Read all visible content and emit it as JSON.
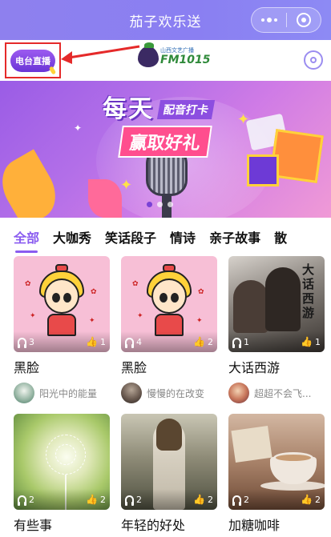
{
  "app": {
    "title": "茄子欢乐送"
  },
  "header": {
    "live_badge": "电台直播",
    "station_small": "山西文艺广播",
    "station_freq": "FM1015"
  },
  "banner": {
    "line1_big": "每天",
    "line1_tag": "配音打卡",
    "line2": "赢取好礼",
    "active_dot": 0,
    "dot_count": 3
  },
  "tabs": [
    {
      "label": "全部"
    },
    {
      "label": "大咖秀"
    },
    {
      "label": "笑话段子"
    },
    {
      "label": "情诗"
    },
    {
      "label": "亲子故事"
    },
    {
      "label": "散"
    }
  ],
  "cards": [
    {
      "title": "黑脸",
      "listens": "3",
      "likes": "1",
      "author": "阳光中的能量",
      "art": "cartoon-girl"
    },
    {
      "title": "黑脸",
      "listens": "4",
      "likes": "2",
      "author": "慢慢的在改变",
      "art": "cartoon-girl"
    },
    {
      "title": "大话西游",
      "listens": "1",
      "likes": "1",
      "author": "超超不会飞...",
      "art": "movie-poster",
      "poster_text": "大话西游"
    },
    {
      "title": "有些事",
      "listens": "2",
      "likes": "2",
      "author": "",
      "art": "dandelion-field"
    },
    {
      "title": "年轻的好处",
      "listens": "2",
      "likes": "2",
      "author": "",
      "art": "girl-in-forest"
    },
    {
      "title": "加糖咖啡",
      "listens": "2",
      "likes": "2",
      "author": "",
      "art": "coffee-cup"
    }
  ],
  "colors": {
    "accent": "#8a5cf0",
    "titlebar": "#8e80ee",
    "annotation": "#e52a2a"
  }
}
